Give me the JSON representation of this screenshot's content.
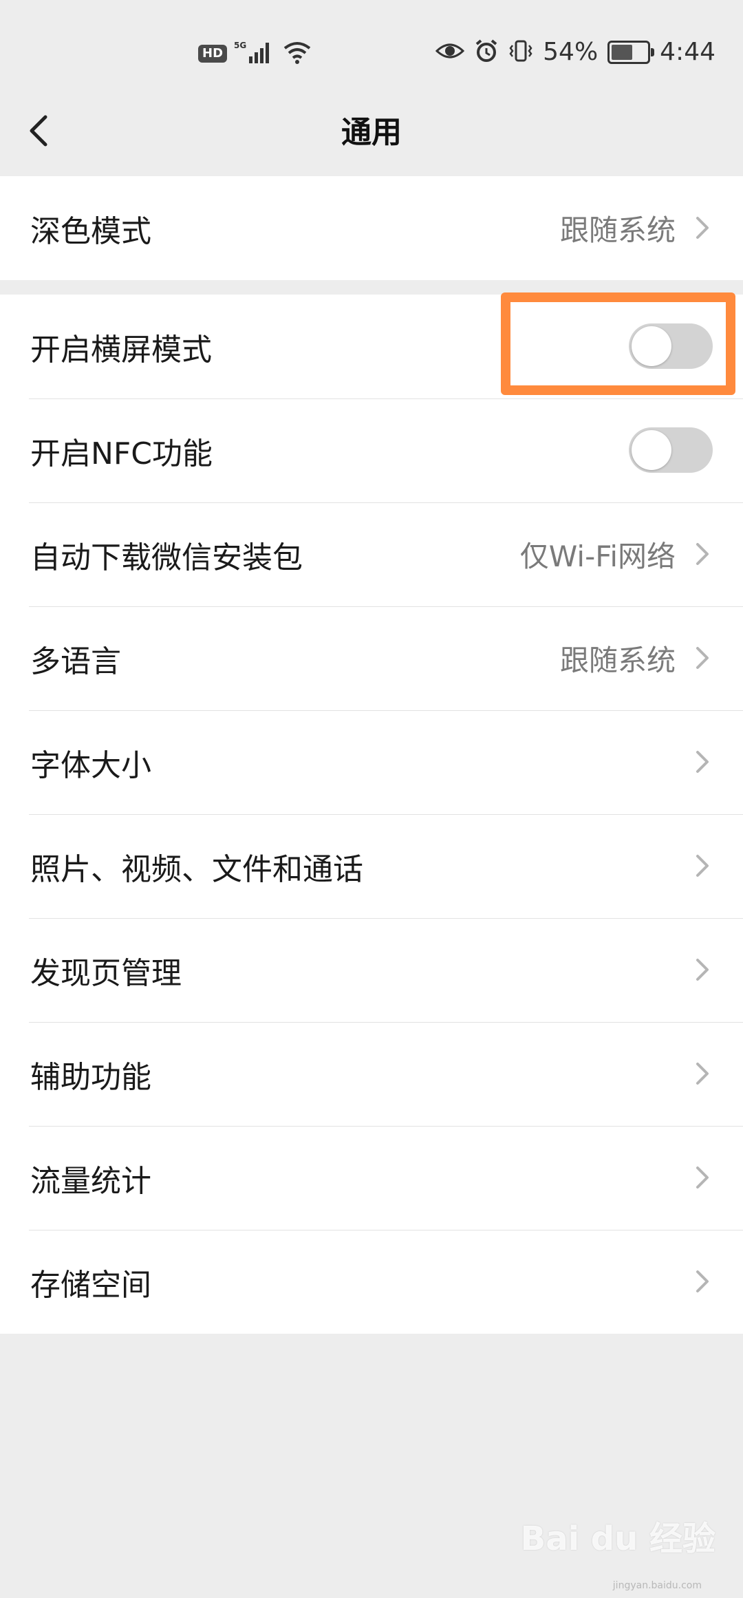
{
  "status_bar": {
    "hd_badge": "HD",
    "network": "5G",
    "battery_percent": "54%",
    "time": "4:44",
    "icons": [
      "hd-icon",
      "signal-icon",
      "wifi-icon",
      "eye-icon",
      "alarm-icon",
      "vibrate-icon",
      "battery-icon"
    ]
  },
  "header": {
    "title": "通用",
    "back_icon": "chevron-left-icon"
  },
  "section1": {
    "rows": [
      {
        "label": "深色模式",
        "value": "跟随系统"
      }
    ]
  },
  "section2": {
    "rows": [
      {
        "label": "开启横屏模式",
        "toggle": false
      },
      {
        "label": "开启NFC功能",
        "toggle": false
      },
      {
        "label": "自动下载微信安装包",
        "value": "仅Wi-Fi网络"
      },
      {
        "label": "多语言",
        "value": "跟随系统"
      },
      {
        "label": "字体大小"
      },
      {
        "label": "照片、视频、文件和通话"
      },
      {
        "label": "发现页管理"
      },
      {
        "label": "辅助功能"
      },
      {
        "label": "流量统计"
      },
      {
        "label": "存储空间"
      }
    ]
  },
  "highlight_color": "#ff8a3d",
  "watermark": {
    "text": "Bai du 经验",
    "sub": "jingyan.baidu.com"
  }
}
